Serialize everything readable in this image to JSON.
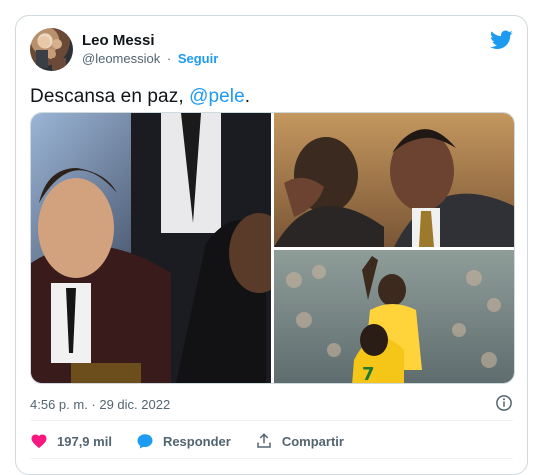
{
  "author": {
    "display_name": "Leo Messi",
    "handle": "@leomessiok",
    "separator": "·",
    "follow_label": "Seguir"
  },
  "tweet": {
    "text": "Descansa en paz, ",
    "mention": "@pele",
    "text_end": "."
  },
  "media": [
    {
      "icon": "photo-messi-pele-event"
    },
    {
      "icon": "photo-messi-pele-hug"
    },
    {
      "icon": "photo-pele-celebration"
    }
  ],
  "meta": {
    "timestamp": "4:56 p. m. · 29 dic. 2022"
  },
  "actions": {
    "likes": "197,9 mil",
    "reply_label": "Responder",
    "share_label": "Compartir"
  },
  "colors": {
    "accent": "#1d9bf0",
    "like": "#f91880",
    "text_secondary": "#536471",
    "border": "#cfd9de"
  }
}
